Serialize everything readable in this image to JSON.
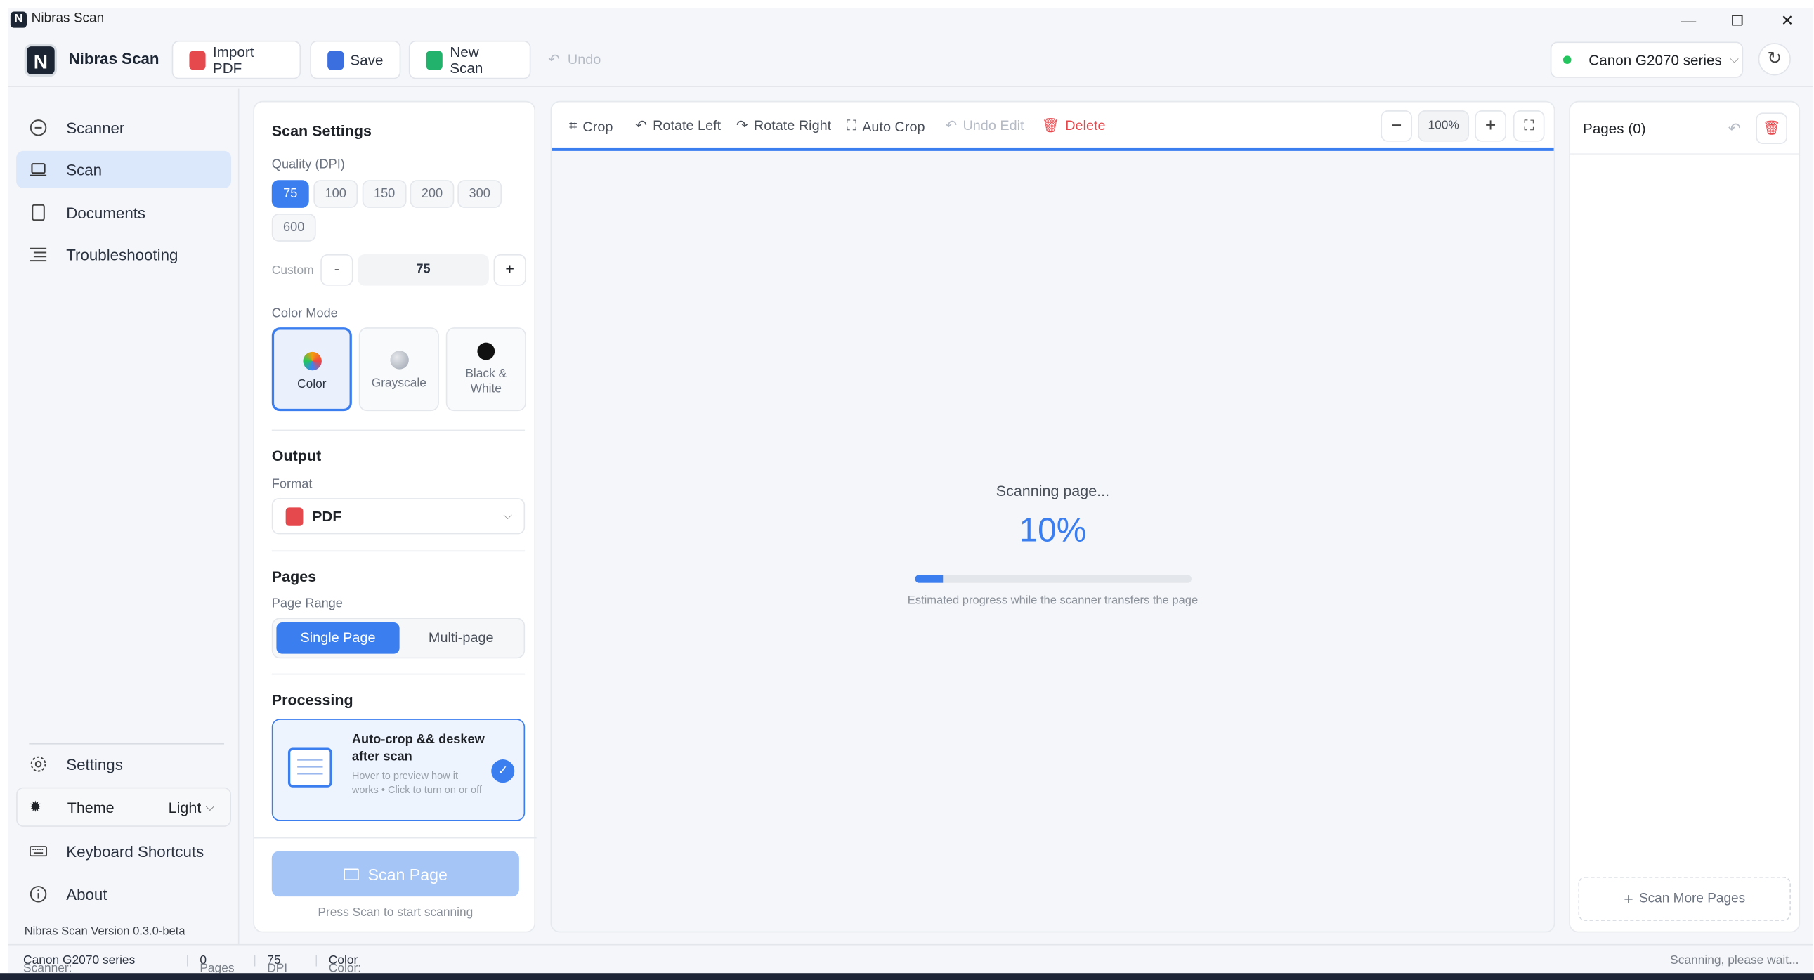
{
  "window": {
    "title": "Nibras Scan",
    "minimize": "—",
    "restore": "❐",
    "close": "✕"
  },
  "toolbar": {
    "logo": "N",
    "brand": "Nibras Scan",
    "import_pdf": "Import PDF",
    "save": "Save",
    "new_scan": "New Scan",
    "undo": "Undo",
    "scanner": "Canon G2070 series",
    "scanner_status_color": "#22c55e"
  },
  "sidebar": {
    "items": [
      {
        "label": "Scanner",
        "icon": "scanner-icon"
      },
      {
        "label": "Scan",
        "icon": "scan-icon"
      },
      {
        "label": "Documents",
        "icon": "documents-icon"
      },
      {
        "label": "Troubleshooting",
        "icon": "troubleshooting-icon"
      }
    ],
    "settings": "Settings",
    "theme_label": "Theme",
    "theme_value": "Light",
    "shortcuts": "Keyboard Shortcuts",
    "about": "About",
    "version": "Nibras Scan Version 0.3.0-beta"
  },
  "scan_settings": {
    "title": "Scan Settings",
    "quality_label": "Quality (DPI)",
    "dpi_options": [
      "75",
      "100",
      "150",
      "200",
      "300",
      "600"
    ],
    "dpi_selected": "75",
    "custom_label": "Custom",
    "custom_minus": "-",
    "custom_value": "75",
    "custom_plus": "+",
    "color_mode_label": "Color Mode",
    "color_modes": [
      "Color",
      "Grayscale",
      "Black & White"
    ],
    "color_mode_selected": "Color",
    "output_title": "Output",
    "format_label": "Format",
    "format_value": "PDF",
    "pages_title": "Pages",
    "page_range_label": "Page Range",
    "page_range_options": [
      "Single Page",
      "Multi-page"
    ],
    "page_range_selected": "Single Page",
    "processing_title": "Processing",
    "autocrop_title": "Auto-crop && deskew after scan",
    "autocrop_desc": "Hover to preview how it works • Click to turn on or off",
    "autocrop_enabled": true,
    "scan_button": "Scan Page",
    "scan_hint": "Press Scan to start scanning"
  },
  "preview": {
    "tools": [
      "Crop",
      "Rotate Left",
      "Rotate Right",
      "Auto Crop",
      "Undo Edit",
      "Delete"
    ],
    "zoom": "100%",
    "status_title": "Scanning page...",
    "progress_text": "10%",
    "progress": 0.1,
    "progress_caption": "Estimated progress while the scanner transfers the page",
    "accent": "#3b7ef0"
  },
  "pages": {
    "title": "Pages (0)",
    "scan_more": "Scan More Pages"
  },
  "statusbar": {
    "scanner_label": "Scanner:",
    "scanner_value": "Canon G2070 series",
    "pages_label": "Pages",
    "pages_value": "0",
    "dpi_label": "DPI",
    "dpi_value": "75",
    "color_label": "Color:",
    "color_value": "Color",
    "state": "Scanning, please wait..."
  }
}
